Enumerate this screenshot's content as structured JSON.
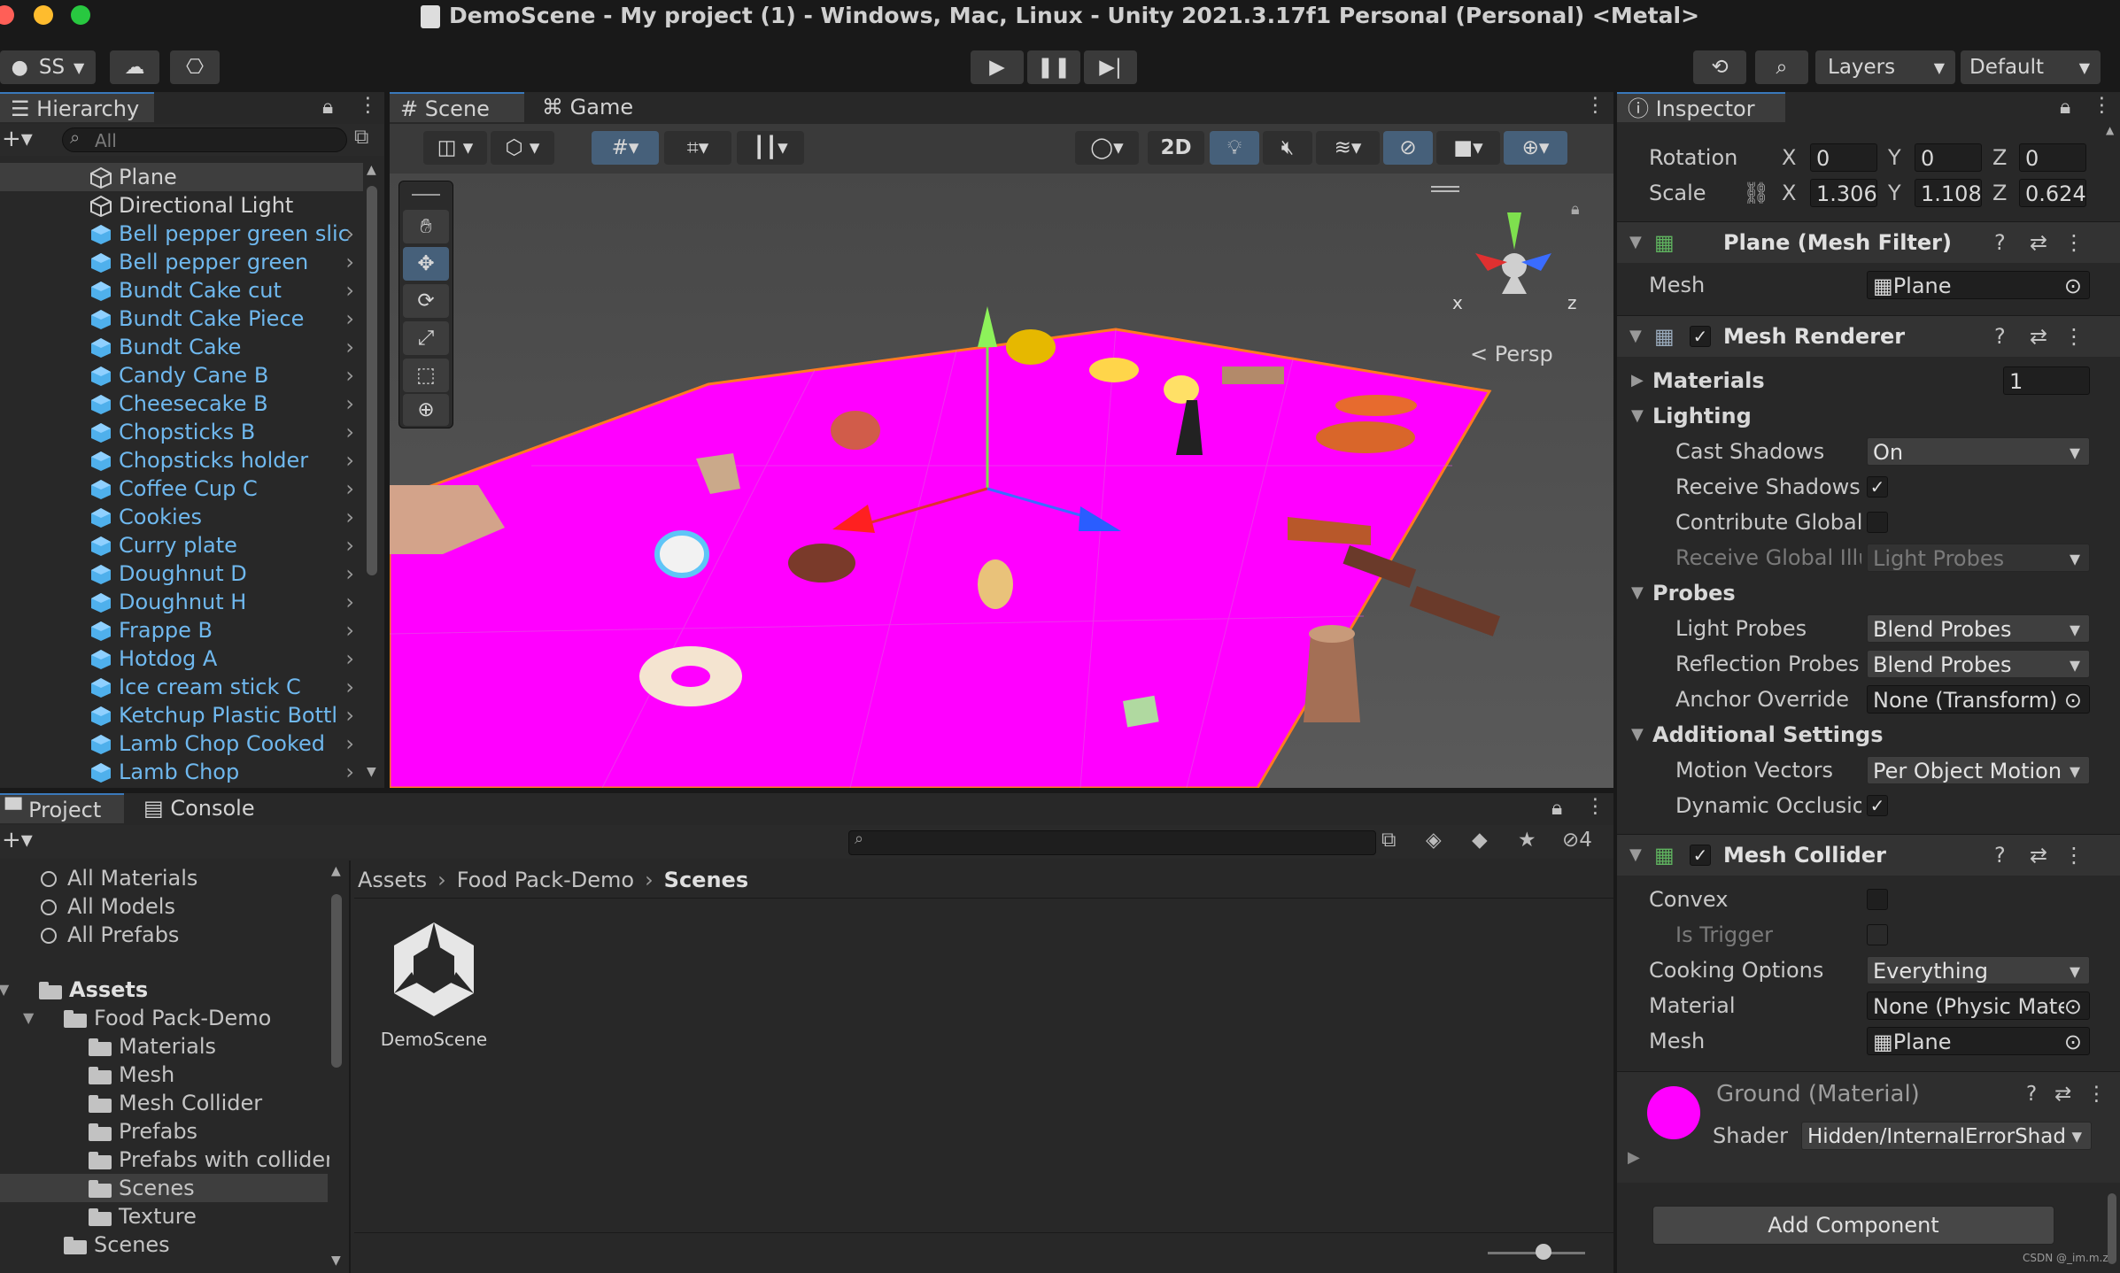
{
  "window": {
    "title": "DemoScene - My project (1) - Windows, Mac, Linux - Unity 2021.3.17f1 Personal (Personal) <Metal>"
  },
  "toolbar": {
    "account": "SS",
    "layers": "Layers",
    "layout": "Default"
  },
  "hierarchy": {
    "tab": "Hierarchy",
    "search_placeholder": "All",
    "items": [
      {
        "label": "Plane",
        "kind": "object"
      },
      {
        "label": "Directional Light",
        "kind": "object"
      },
      {
        "label": "Bell pepper green slic",
        "kind": "prefab"
      },
      {
        "label": "Bell pepper green",
        "kind": "prefab"
      },
      {
        "label": "Bundt Cake cut",
        "kind": "prefab"
      },
      {
        "label": "Bundt Cake Piece",
        "kind": "prefab"
      },
      {
        "label": "Bundt Cake",
        "kind": "prefab"
      },
      {
        "label": "Candy Cane B",
        "kind": "prefab"
      },
      {
        "label": "Cheesecake B",
        "kind": "prefab"
      },
      {
        "label": "Chopsticks B",
        "kind": "prefab"
      },
      {
        "label": "Chopsticks holder",
        "kind": "prefab"
      },
      {
        "label": "Coffee Cup C",
        "kind": "prefab"
      },
      {
        "label": "Cookies",
        "kind": "prefab"
      },
      {
        "label": "Curry plate",
        "kind": "prefab"
      },
      {
        "label": "Doughnut D",
        "kind": "prefab"
      },
      {
        "label": "Doughnut H",
        "kind": "prefab"
      },
      {
        "label": "Frappe B",
        "kind": "prefab"
      },
      {
        "label": "Hotdog A",
        "kind": "prefab"
      },
      {
        "label": "Ice cream stick C",
        "kind": "prefab"
      },
      {
        "label": "Ketchup Plastic Bottl",
        "kind": "prefab"
      },
      {
        "label": "Lamb Chop Cooked",
        "kind": "prefab"
      },
      {
        "label": "Lamb Chop",
        "kind": "prefab"
      }
    ]
  },
  "scene": {
    "tabs": [
      "Scene",
      "Game"
    ],
    "mode_2d": "2D",
    "persp_label": "< Persp",
    "gizmo_axes": {
      "x": "x",
      "z": "z"
    }
  },
  "project": {
    "tabs": [
      "Project",
      "Console"
    ],
    "hidden_count": "4",
    "favorites": [
      "All Materials",
      "All Models",
      "All Prefabs"
    ],
    "tree": [
      {
        "label": "Assets",
        "depth": 0,
        "bold": true
      },
      {
        "label": "Food Pack-Demo",
        "depth": 1
      },
      {
        "label": "Materials",
        "depth": 2
      },
      {
        "label": "Mesh",
        "depth": 2
      },
      {
        "label": "Mesh Collider",
        "depth": 2
      },
      {
        "label": "Prefabs",
        "depth": 2
      },
      {
        "label": "Prefabs with colliders",
        "depth": 2
      },
      {
        "label": "Scenes",
        "depth": 2,
        "selected": true
      },
      {
        "label": "Texture",
        "depth": 2
      },
      {
        "label": "Scenes",
        "depth": 1
      }
    ],
    "breadcrumb": [
      "Assets",
      "Food Pack-Demo",
      "Scenes"
    ],
    "asset_name": "DemoScene"
  },
  "inspector": {
    "tab": "Inspector",
    "transform": {
      "rotation_label": "Rotation",
      "rotation": {
        "x": "0",
        "y": "0",
        "z": "0"
      },
      "scale_label": "Scale",
      "scale": {
        "x": "1.3065",
        "y": "1.1087",
        "z": "0.6245"
      }
    },
    "mesh_filter": {
      "title": "Plane (Mesh Filter)",
      "mesh_label": "Mesh",
      "mesh_value": "Plane"
    },
    "mesh_renderer": {
      "title": "Mesh Renderer",
      "materials_label": "Materials",
      "materials_count": "1",
      "lighting_label": "Lighting",
      "cast_shadows_label": "Cast Shadows",
      "cast_shadows_value": "On",
      "receive_shadows_label": "Receive Shadows",
      "contribute_gi_label": "Contribute Global I",
      "receive_gi_label": "Receive Global Illu",
      "receive_gi_value": "Light Probes",
      "probes_label": "Probes",
      "light_probes_label": "Light Probes",
      "light_probes_value": "Blend Probes",
      "reflection_probes_label": "Reflection Probes",
      "reflection_probes_value": "Blend Probes",
      "anchor_override_label": "Anchor Override",
      "anchor_override_value": "None (Transform)",
      "additional_label": "Additional Settings",
      "motion_vectors_label": "Motion Vectors",
      "motion_vectors_value": "Per Object Motion",
      "dynamic_occlusion_label": "Dynamic Occlusioi"
    },
    "mesh_collider": {
      "title": "Mesh Collider",
      "convex_label": "Convex",
      "is_trigger_label": "Is Trigger",
      "cooking_label": "Cooking Options",
      "cooking_value": "Everything",
      "material_label": "Material",
      "material_value": "None (Physic Mate",
      "mesh_label": "Mesh",
      "mesh_value": "Plane"
    },
    "material": {
      "title": "Ground (Material)",
      "shader_label": "Shader",
      "shader_value": "Hidden/InternalErrorShad",
      "color": "#ff00ff"
    },
    "add_component": "Add Component",
    "watermark": "CSDN @_im.m.z"
  }
}
